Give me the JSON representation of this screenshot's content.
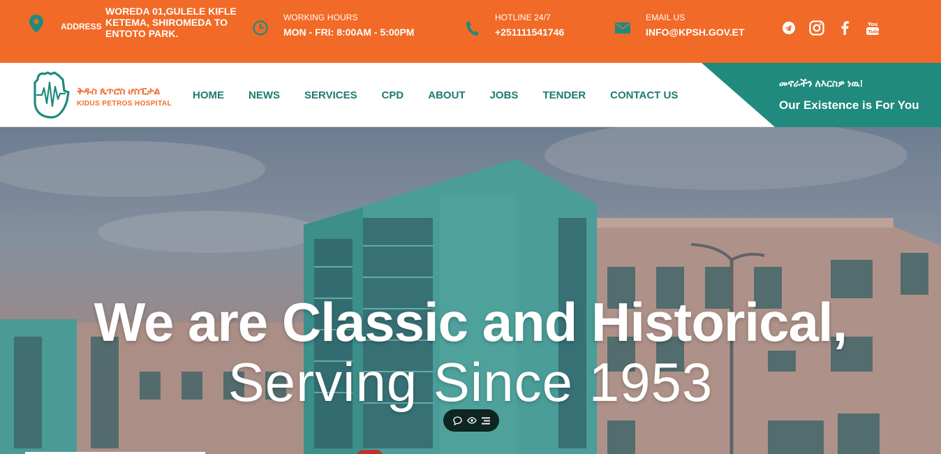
{
  "topbar": {
    "address": {
      "label": "ADDRESS",
      "value": "WOREDA 01,GULELE KIFLE KETEMA, SHIROMEDA TO ENTOTO PARK.",
      "icon": "map-pin-icon"
    },
    "hours": {
      "label": "WORKING HOURS",
      "value": "MON - FRI: 8:00AM - 5:00PM",
      "icon": "clock-icon"
    },
    "hotline": {
      "label": "HOTLINE 24/7",
      "value": "+251111541746",
      "icon": "phone-icon"
    },
    "email": {
      "label": "EMAIL US",
      "value": "INFO@KPSH.GOV.ET",
      "icon": "envelope-icon"
    },
    "social": [
      "telegram-icon",
      "instagram-icon",
      "facebook-icon",
      "youtube-icon"
    ],
    "colors": {
      "background": "#f26a27",
      "icon": "#1e8a7e"
    }
  },
  "logo": {
    "amharic": "ቅዱስ ጴጥሮስ ሆስፒታል",
    "english": "KIDUS PETROS HOSPITAL"
  },
  "menu": {
    "items": [
      "HOME",
      "NEWS",
      "SERVICES",
      "CPD",
      "ABOUT",
      "JOBS",
      "TENDER",
      "CONTACT US"
    ],
    "color": "#1e7a70"
  },
  "tagline": {
    "amharic": "መኖራችን ለእርስዎ ነዉ!",
    "english": "Our Existence is For You",
    "background": "#1f8a7d"
  },
  "hero": {
    "title": "We are Classic and Historical,",
    "subtitle": "Serving Since 1953",
    "widget_icons": [
      "chat-bubble-icon",
      "eye-icon",
      "list-icon"
    ]
  }
}
